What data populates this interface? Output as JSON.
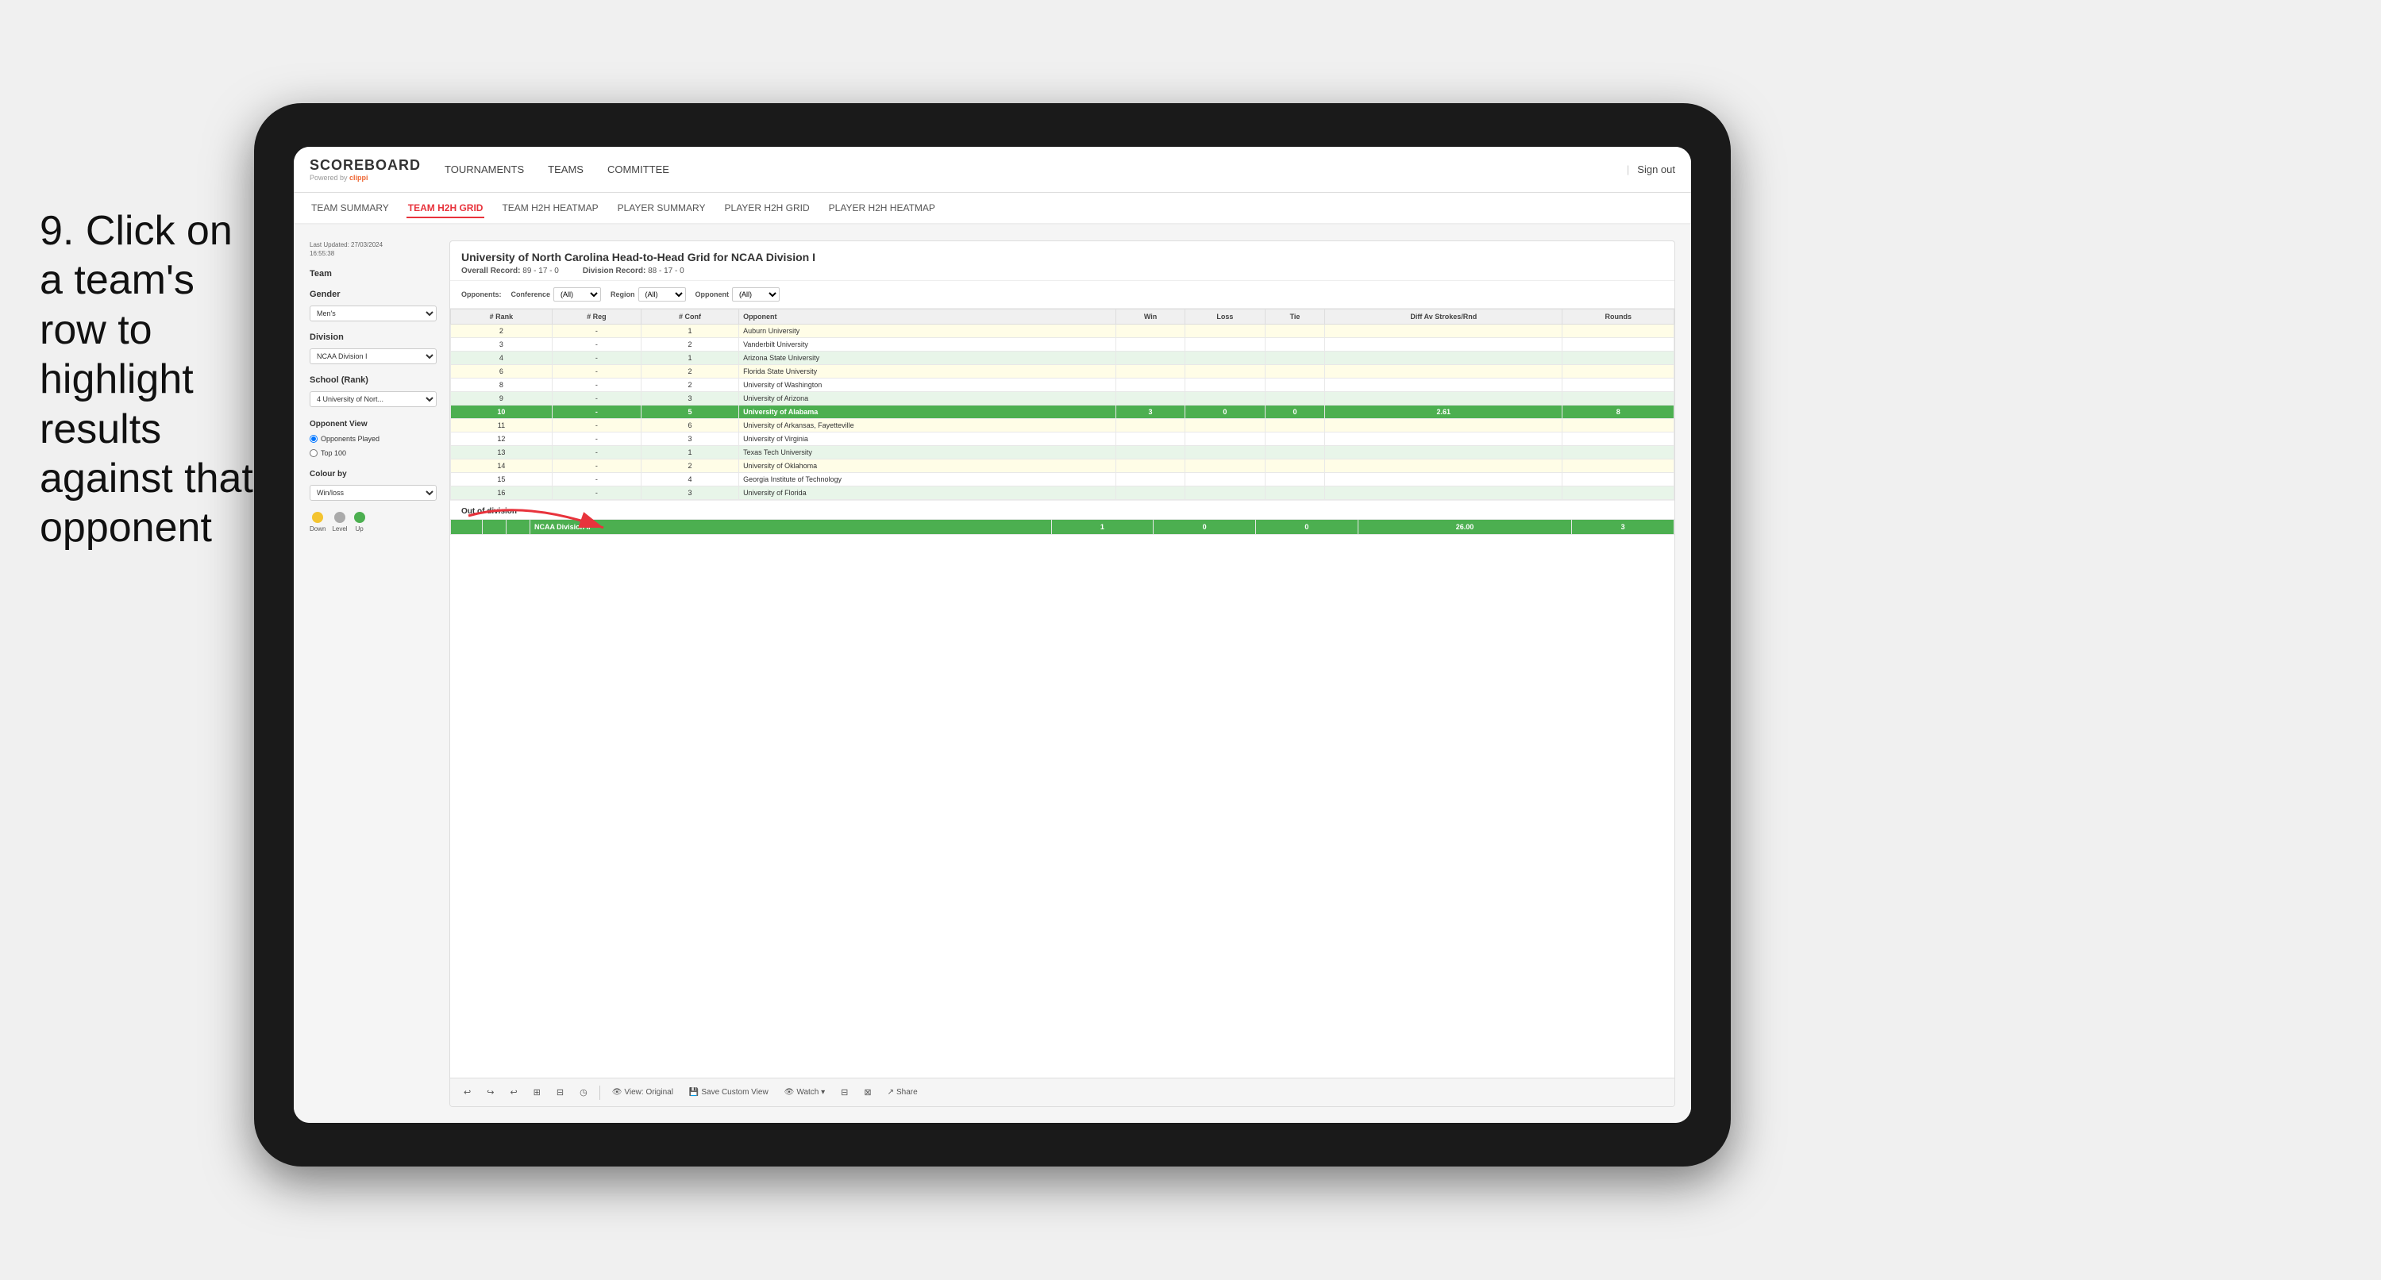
{
  "instruction": {
    "number": "9.",
    "text": "Click on a team's row to highlight results against that opponent"
  },
  "app": {
    "logo": "SCOREBOARD",
    "powered_by": "Powered by",
    "brand": "clippi",
    "nav_items": [
      "TOURNAMENTS",
      "TEAMS",
      "COMMITTEE"
    ],
    "sign_out_divider": "|",
    "sign_out": "Sign out"
  },
  "sub_nav": {
    "items": [
      "TEAM SUMMARY",
      "TEAM H2H GRID",
      "TEAM H2H HEATMAP",
      "PLAYER SUMMARY",
      "PLAYER H2H GRID",
      "PLAYER H2H HEATMAP"
    ],
    "active": "TEAM H2H GRID"
  },
  "left_panel": {
    "last_updated_label": "Last Updated: 27/03/2024",
    "last_updated_time": "16:55:38",
    "team_label": "Team",
    "gender_label": "Gender",
    "gender_value": "Men's",
    "division_label": "Division",
    "division_value": "NCAA Division I",
    "school_rank_label": "School (Rank)",
    "school_rank_value": "4 University of Nort...",
    "opponent_view_label": "Opponent View",
    "opponents_played": "Opponents Played",
    "top_100": "Top 100",
    "colour_by_label": "Colour by",
    "colour_by_value": "Win/loss",
    "legend": [
      {
        "color": "#f4c430",
        "label": "Down"
      },
      {
        "color": "#aaa",
        "label": "Level"
      },
      {
        "color": "#4caf50",
        "label": "Up"
      }
    ]
  },
  "grid": {
    "title": "University of North Carolina Head-to-Head Grid for NCAA Division I",
    "overall_record_label": "Overall Record:",
    "overall_record": "89 - 17 - 0",
    "division_record_label": "Division Record:",
    "division_record": "88 - 17 - 0",
    "filters": {
      "conference_label": "Conference",
      "conference_value": "(All)",
      "region_label": "Region",
      "region_value": "(All)",
      "opponent_label": "Opponent",
      "opponent_value": "(All)",
      "opponents_label": "Opponents:"
    },
    "columns": [
      "# Rank",
      "# Reg",
      "# Conf",
      "Opponent",
      "Win",
      "Loss",
      "Tie",
      "Diff Av Strokes/Rnd",
      "Rounds"
    ],
    "rows": [
      {
        "rank": "2",
        "reg": "-",
        "conf": "1",
        "opponent": "Auburn University",
        "win": "",
        "loss": "",
        "tie": "",
        "diff": "",
        "rounds": "",
        "style": "light-yellow"
      },
      {
        "rank": "3",
        "reg": "-",
        "conf": "2",
        "opponent": "Vanderbilt University",
        "win": "",
        "loss": "",
        "tie": "",
        "diff": "",
        "rounds": "",
        "style": "normal"
      },
      {
        "rank": "4",
        "reg": "-",
        "conf": "1",
        "opponent": "Arizona State University",
        "win": "",
        "loss": "",
        "tie": "",
        "diff": "",
        "rounds": "",
        "style": "light-green"
      },
      {
        "rank": "6",
        "reg": "-",
        "conf": "2",
        "opponent": "Florida State University",
        "win": "",
        "loss": "",
        "tie": "",
        "diff": "",
        "rounds": "",
        "style": "light-yellow"
      },
      {
        "rank": "8",
        "reg": "-",
        "conf": "2",
        "opponent": "University of Washington",
        "win": "",
        "loss": "",
        "tie": "",
        "diff": "",
        "rounds": "",
        "style": "normal"
      },
      {
        "rank": "9",
        "reg": "-",
        "conf": "3",
        "opponent": "University of Arizona",
        "win": "",
        "loss": "",
        "tie": "",
        "diff": "",
        "rounds": "",
        "style": "light-green"
      },
      {
        "rank": "10",
        "reg": "-",
        "conf": "5",
        "opponent": "University of Alabama",
        "win": "3",
        "loss": "0",
        "tie": "0",
        "diff": "2.61",
        "rounds": "8",
        "style": "highlighted"
      },
      {
        "rank": "11",
        "reg": "-",
        "conf": "6",
        "opponent": "University of Arkansas, Fayetteville",
        "win": "",
        "loss": "",
        "tie": "",
        "diff": "",
        "rounds": "",
        "style": "light-yellow"
      },
      {
        "rank": "12",
        "reg": "-",
        "conf": "3",
        "opponent": "University of Virginia",
        "win": "",
        "loss": "",
        "tie": "",
        "diff": "",
        "rounds": "",
        "style": "normal"
      },
      {
        "rank": "13",
        "reg": "-",
        "conf": "1",
        "opponent": "Texas Tech University",
        "win": "",
        "loss": "",
        "tie": "",
        "diff": "",
        "rounds": "",
        "style": "light-green"
      },
      {
        "rank": "14",
        "reg": "-",
        "conf": "2",
        "opponent": "University of Oklahoma",
        "win": "",
        "loss": "",
        "tie": "",
        "diff": "",
        "rounds": "",
        "style": "light-yellow"
      },
      {
        "rank": "15",
        "reg": "-",
        "conf": "4",
        "opponent": "Georgia Institute of Technology",
        "win": "",
        "loss": "",
        "tie": "",
        "diff": "",
        "rounds": "",
        "style": "normal"
      },
      {
        "rank": "16",
        "reg": "-",
        "conf": "3",
        "opponent": "University of Florida",
        "win": "",
        "loss": "",
        "tie": "",
        "diff": "",
        "rounds": "",
        "style": "light-green"
      }
    ],
    "out_of_division_label": "Out of division",
    "out_of_division_row": {
      "division": "NCAA Division II",
      "win": "1",
      "loss": "0",
      "tie": "0",
      "diff": "26.00",
      "rounds": "3"
    }
  },
  "toolbar": {
    "undo": "↩",
    "redo": "↪",
    "undo2": "↩",
    "copy": "⊞",
    "paste": "⊟",
    "time": "◷",
    "view_label": "View: Original",
    "save_custom_label": "Save Custom View",
    "watch_label": "Watch ▾",
    "share_label": "Share"
  }
}
